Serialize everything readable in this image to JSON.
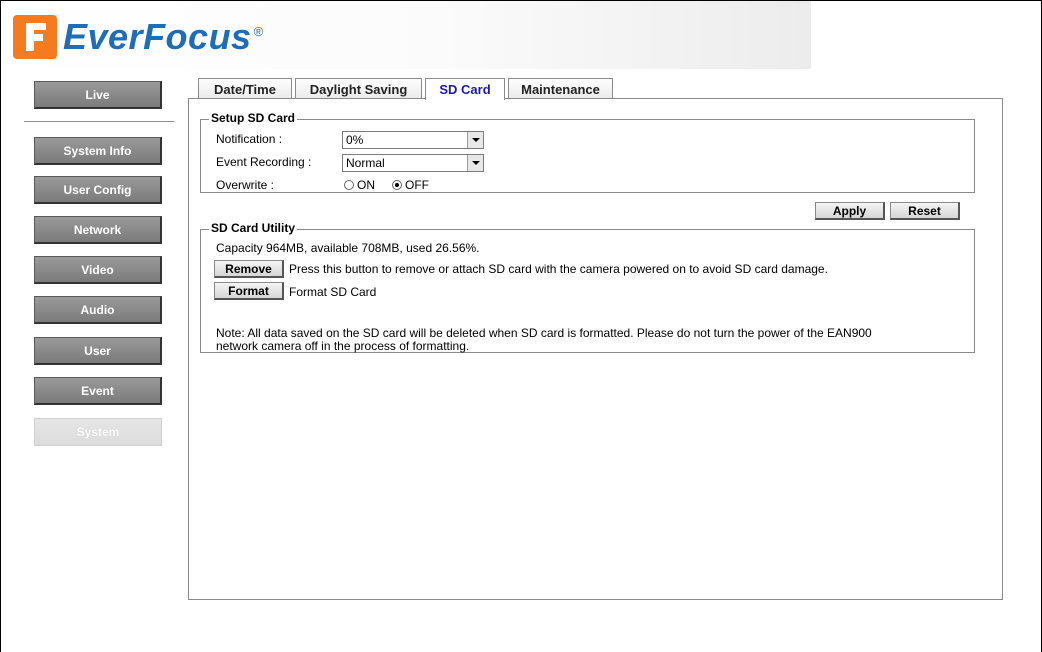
{
  "brand": {
    "name": "EverFocus",
    "reg": "®",
    "mark_color": "#f47b20",
    "text_color": "#1e6db5"
  },
  "sidebar": {
    "items": [
      {
        "label": "Live"
      },
      {
        "label": "System Info"
      },
      {
        "label": "User Config"
      },
      {
        "label": "Network"
      },
      {
        "label": "Video"
      },
      {
        "label": "Audio"
      },
      {
        "label": "User"
      },
      {
        "label": "Event"
      },
      {
        "label": "System",
        "active": true
      }
    ]
  },
  "tabs": [
    {
      "label": "Date/Time"
    },
    {
      "label": "Daylight Saving"
    },
    {
      "label": "SD Card",
      "active": true
    },
    {
      "label": "Maintenance"
    }
  ],
  "setup": {
    "legend": "Setup SD Card",
    "notification_label": "Notification :",
    "notification_value": "0%",
    "event_recording_label": "Event Recording :",
    "event_recording_value": "Normal",
    "overwrite_label": "Overwrite :",
    "overwrite_on": "ON",
    "overwrite_off": "OFF",
    "overwrite_selected": "OFF"
  },
  "actions": {
    "apply": "Apply",
    "reset": "Reset"
  },
  "utility": {
    "legend": "SD Card Utility",
    "capacity": "Capacity 964MB, available 708MB, used 26.56%.",
    "remove_button": "Remove",
    "remove_desc": "Press this button to remove or attach SD card with the camera powered on to avoid SD card damage.",
    "format_button": "Format",
    "format_desc": "Format SD Card",
    "note_line1": "Note: All data saved on the SD card will be deleted when SD card is formatted. Please do not turn the power of the EAN900",
    "note_line2": "network camera off in the process of formatting."
  }
}
